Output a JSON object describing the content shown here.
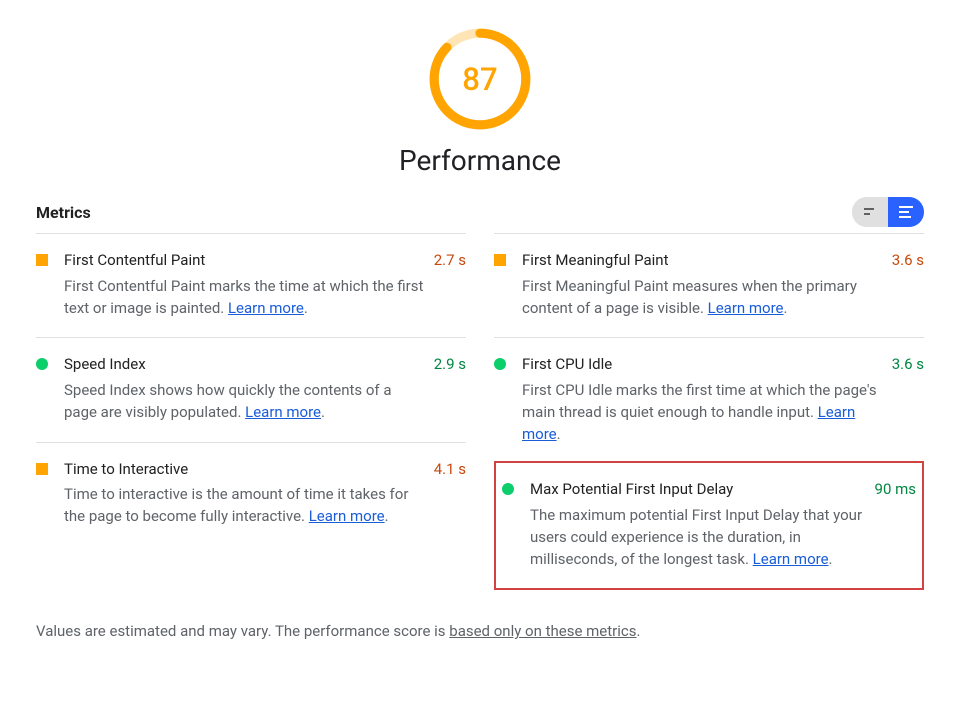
{
  "gauge": {
    "score": "87",
    "percent": 87,
    "title": "Performance"
  },
  "header": {
    "metrics_label": "Metrics"
  },
  "columns": {
    "left": [
      {
        "name": "First Contentful Paint",
        "desc": "First Contentful Paint marks the time at which the first text or image is painted. ",
        "learn": "Learn more",
        "value": "2.7 s",
        "status": "orange"
      },
      {
        "name": "Speed Index",
        "desc": "Speed Index shows how quickly the contents of a page are visibly populated. ",
        "learn": "Learn more",
        "value": "2.9 s",
        "status": "green"
      },
      {
        "name": "Time to Interactive",
        "desc": "Time to interactive is the amount of time it takes for the page to become fully interactive. ",
        "learn": "Learn more",
        "value": "4.1 s",
        "status": "orange"
      }
    ],
    "right": [
      {
        "name": "First Meaningful Paint",
        "desc": "First Meaningful Paint measures when the primary content of a page is visible. ",
        "learn": "Learn more",
        "value": "3.6 s",
        "status": "orange"
      },
      {
        "name": "First CPU Idle",
        "desc": "First CPU Idle marks the first time at which the page's main thread is quiet enough to handle input. ",
        "learn": "Learn more",
        "value": "3.6 s",
        "status": "green"
      },
      {
        "name": "Max Potential First Input Delay",
        "desc": "The maximum potential First Input Delay that your users could experience is the duration, in milliseconds, of the longest task. ",
        "learn": "Learn more",
        "value": "90 ms",
        "status": "green",
        "highlighted": true
      }
    ]
  },
  "footnote": {
    "prefix": "Values are estimated and may vary. The performance score is ",
    "link": "based only on these metrics",
    "suffix": "."
  }
}
